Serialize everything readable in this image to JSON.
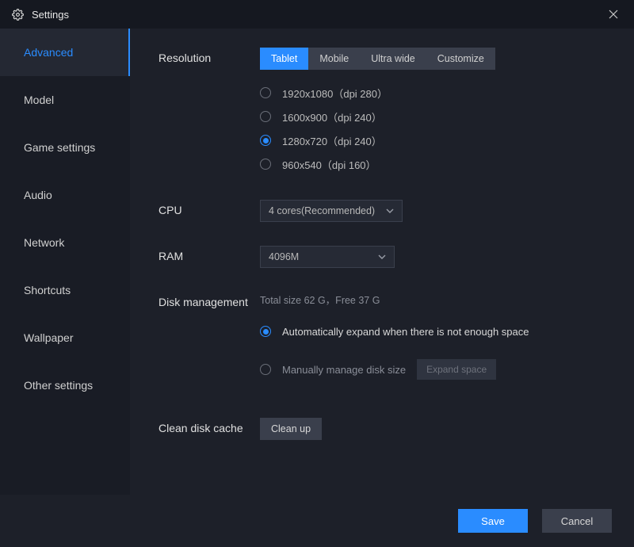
{
  "title": "Settings",
  "sidebar": {
    "items": [
      {
        "label": "Advanced"
      },
      {
        "label": "Model"
      },
      {
        "label": "Game settings"
      },
      {
        "label": "Audio"
      },
      {
        "label": "Network"
      },
      {
        "label": "Shortcuts"
      },
      {
        "label": "Wallpaper"
      },
      {
        "label": "Other settings"
      }
    ],
    "active_index": 0
  },
  "resolution": {
    "label": "Resolution",
    "tabs": [
      {
        "label": "Tablet"
      },
      {
        "label": "Mobile"
      },
      {
        "label": "Ultra wide"
      },
      {
        "label": "Customize"
      }
    ],
    "active_tab": 0,
    "options": [
      {
        "label": "1920x1080（dpi 280）"
      },
      {
        "label": "1600x900（dpi 240）"
      },
      {
        "label": "1280x720（dpi 240）"
      },
      {
        "label": "960x540（dpi 160）"
      }
    ],
    "selected_option": 2
  },
  "cpu": {
    "label": "CPU",
    "value": "4 cores(Recommended)"
  },
  "ram": {
    "label": "RAM",
    "value": "4096M"
  },
  "disk": {
    "label": "Disk management",
    "info": "Total size 62 G，Free 37 G",
    "option_auto": "Automatically expand when there is not enough space",
    "option_manual": "Manually manage disk size",
    "expand_btn": "Expand space",
    "selected": "auto"
  },
  "clean": {
    "label": "Clean disk cache",
    "button": "Clean up"
  },
  "footer": {
    "save": "Save",
    "cancel": "Cancel"
  }
}
